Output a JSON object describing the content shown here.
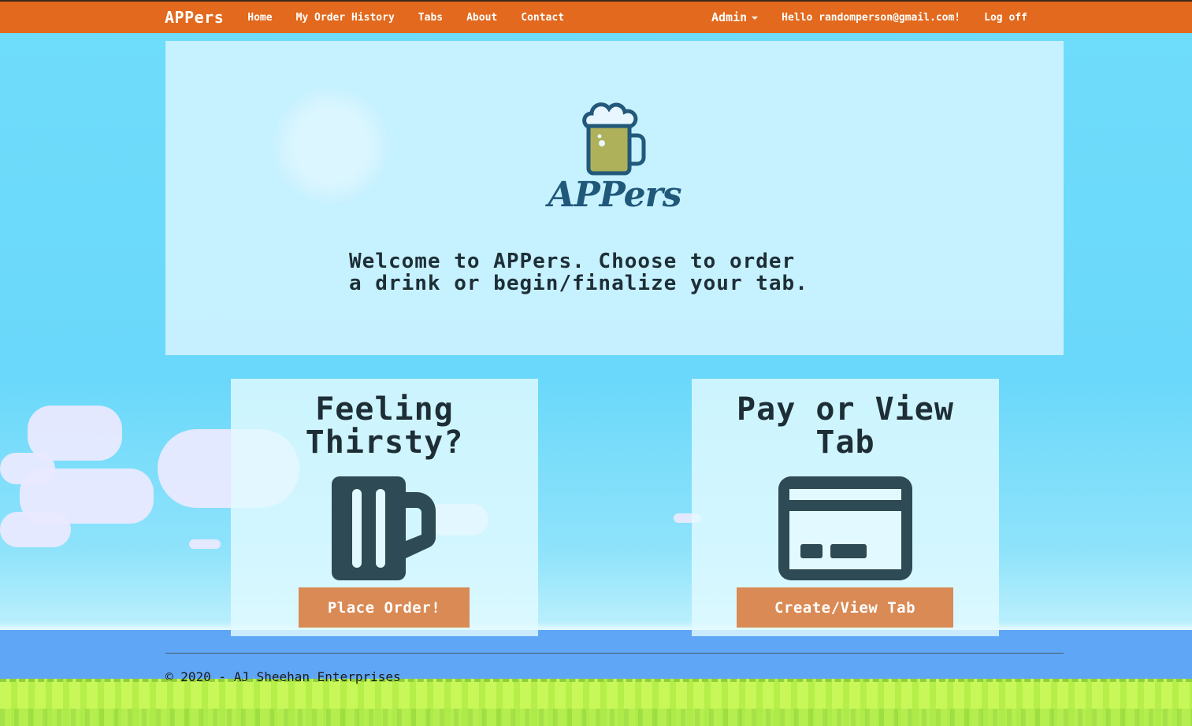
{
  "navbar": {
    "brand": "APPers",
    "links": [
      "Home",
      "My Order History",
      "Tabs",
      "About",
      "Contact"
    ],
    "admin_label": "Admin",
    "greeting": "Hello randomperson@gmail.com!",
    "logoff": "Log off",
    "color": "#e2691d"
  },
  "hero": {
    "logo_text": "APPers",
    "logo_icon": "beer-mug-icon",
    "welcome_line1": "Welcome to APPers. Choose to order",
    "welcome_line2": "a drink or begin/finalize your tab."
  },
  "cards": {
    "order": {
      "title_line1": "Feeling",
      "title_line2": "Thirsty?",
      "icon": "beer-mug-icon",
      "button": "Place Order!"
    },
    "tab": {
      "title_line1": "Pay or View",
      "title_line2": "Tab",
      "icon": "credit-card-icon",
      "button": "Create/View Tab"
    },
    "button_color": "#d98a55"
  },
  "footer": {
    "text": "© 2020 - AJ Sheehan Enterprises"
  }
}
